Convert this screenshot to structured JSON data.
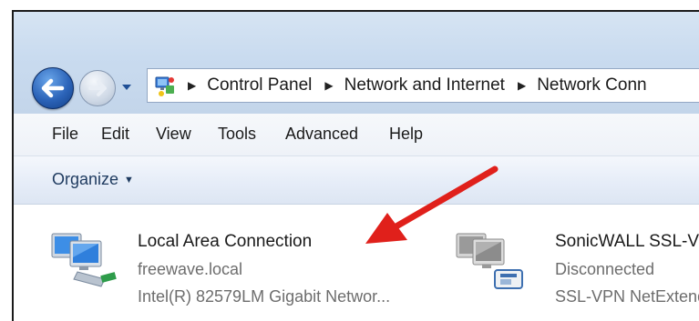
{
  "address_bar": {
    "breadcrumbs": [
      "Control Panel",
      "Network and Internet",
      "Network Conn"
    ]
  },
  "menu": {
    "items": [
      "File",
      "Edit",
      "View",
      "Tools",
      "Advanced",
      "Help"
    ]
  },
  "toolbar": {
    "organize_label": "Organize"
  },
  "connections": [
    {
      "name": "Local Area Connection",
      "status": "freewave.local",
      "device": "Intel(R) 82579LM Gigabit Networ...",
      "icon": "ethernet-adapter-icon"
    },
    {
      "name": "SonicWALL SSL-VP",
      "status": "Disconnected",
      "device": "SSL-VPN NetExtend",
      "icon": "vpn-adapter-icon"
    }
  ],
  "annotation": {
    "arrow_color": "#e0201b"
  }
}
